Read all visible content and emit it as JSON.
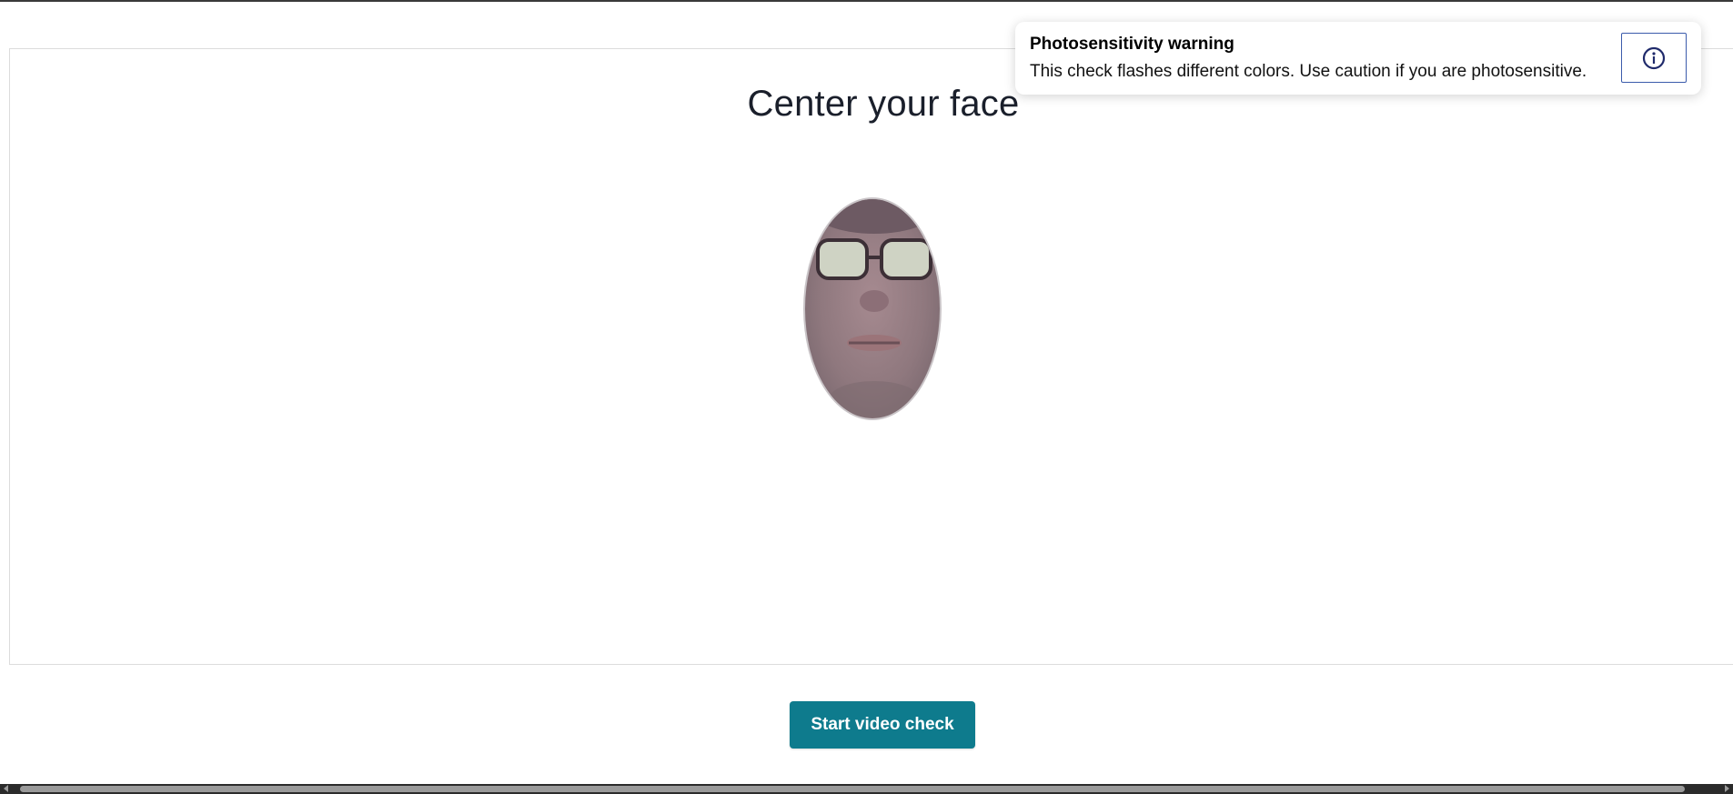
{
  "main": {
    "title": "Center your face",
    "start_button_label": "Start video check"
  },
  "toast": {
    "title": "Photosensitivity warning",
    "body": "This check flashes different colors. Use caution if you are photosensitive.",
    "info_icon": "info-icon"
  },
  "colors": {
    "accent": "#0e7b8d",
    "info_border": "#3b5bab",
    "info_icon": "#1f2a6b"
  },
  "camera_preview": {
    "shape": "oval",
    "icon": "face-camera-preview"
  }
}
